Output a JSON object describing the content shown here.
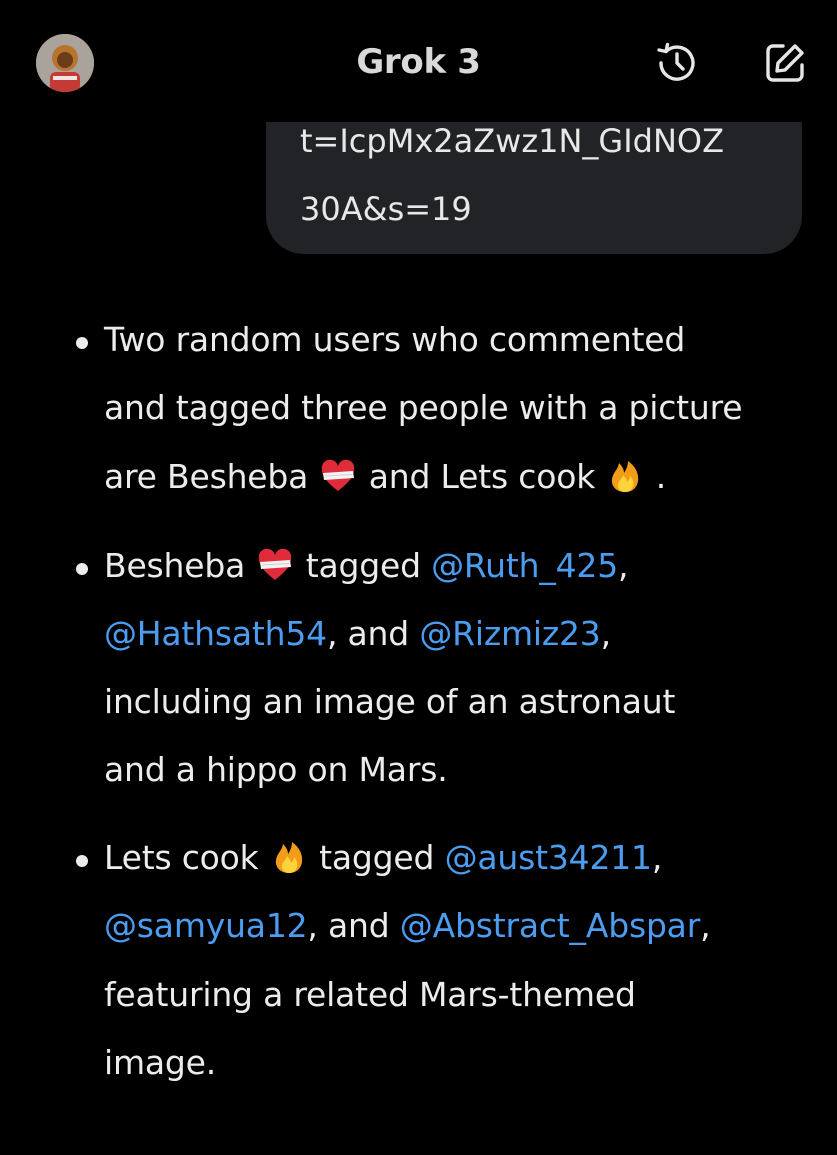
{
  "header": {
    "title": "Grok 3",
    "avatar_icon": "user-avatar-icon",
    "history_icon": "history-icon",
    "edit_icon": "edit-icon"
  },
  "user_message": {
    "lines": [
      "t=IcpMx2aZwz1N_GIdNOZ",
      "30A&s=19"
    ]
  },
  "answer": {
    "bullet1": {
      "l1": "Two random users who commented",
      "l2": "and tagged three people with a picture",
      "l3a": "are Besheba",
      "l3b": "and Lets cook",
      "l3c": "."
    },
    "bullet2": {
      "l1a": "Besheba",
      "l1b": "tagged",
      "m1": "@Ruth_425",
      "l1c": ",",
      "m2": "@Hathsath54",
      "l2a": ", and",
      "m3": "@Rizmiz23",
      "l2b": ",",
      "l3": "including an image of an astronaut",
      "l4": "and a hippo on Mars."
    },
    "bullet3": {
      "l1a": "Lets cook",
      "l1b": "tagged",
      "m1": "@aust34211",
      "l1c": ",",
      "m2": "@samyua12",
      "l2a": ", and",
      "m3": "@Abstract_Abspar",
      "l2b": ",",
      "l3": "featuring a related Mars-themed",
      "l4": "image."
    },
    "emoji_heart": "mending-heart-emoji",
    "emoji_fire": "fire-emoji"
  },
  "colors": {
    "background": "#000000",
    "text": "#ececec",
    "mention": "#4c9cf0",
    "bubble": "#222326"
  }
}
